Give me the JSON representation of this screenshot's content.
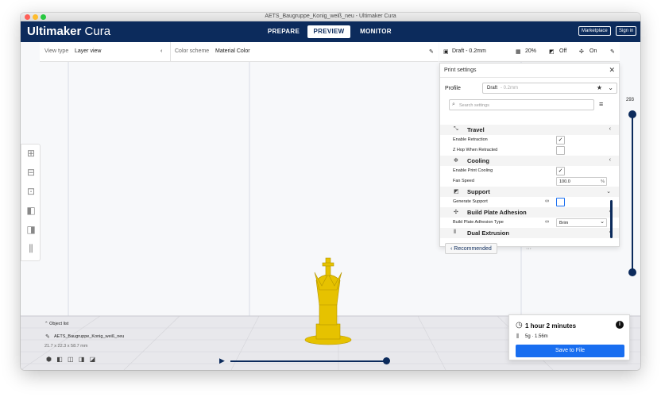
{
  "window": {
    "title": "AETS_Baugruppe_Konig_weiß_neu - Ultimaker Cura"
  },
  "header": {
    "logo_bold": "Ultimaker",
    "logo_light": "Cura",
    "tabs": [
      {
        "label": "PREPARE",
        "active": false
      },
      {
        "label": "PREVIEW",
        "active": true
      },
      {
        "label": "MONITOR",
        "active": false
      }
    ],
    "marketplace_label": "Marketplace",
    "signin_label": "Sign in"
  },
  "viewbar": {
    "view_type_label": "View type",
    "view_type_value": "Layer view",
    "color_scheme_label": "Color scheme",
    "color_scheme_value": "Material Color"
  },
  "settings_summary": {
    "profile": "Draft - 0.2mm",
    "infill": "20%",
    "support": "Off",
    "adhesion": "On"
  },
  "print_settings": {
    "title": "Print settings",
    "profile_label": "Profile",
    "profile_value": "Draft",
    "profile_sub": "- 0.2mm",
    "search_placeholder": "Search settings",
    "categories": {
      "travel": "Travel",
      "cooling": "Cooling",
      "support": "Support",
      "adhesion": "Build Plate Adhesion",
      "dual": "Dual Extrusion"
    },
    "settings": {
      "enable_retraction": "Enable Retraction",
      "z_hop": "Z Hop When Retracted",
      "enable_cooling": "Enable Print Cooling",
      "fan_speed": "Fan Speed",
      "fan_speed_value": "100.0",
      "fan_speed_unit": "%",
      "generate_support": "Generate Support",
      "adhesion_type": "Build Plate Adhesion Type",
      "adhesion_type_value": "Brim"
    },
    "recommended_label": "Recommended"
  },
  "layer_slider": {
    "top_value": "293",
    "fraction": 1.0
  },
  "object_list": {
    "header": "Object list",
    "object_name": "AETS_Baugruppe_Konig_weiß_neu",
    "dimensions": "21.7 x 22.3 x 58.7 mm"
  },
  "print_estimate": {
    "time": "1 hour 2 minutes",
    "material": "5g · 1.56m",
    "save_label": "Save to File"
  },
  "colors": {
    "header_bg": "#0c2b5c",
    "accent": "#196ef0",
    "model": "#e6c200"
  }
}
